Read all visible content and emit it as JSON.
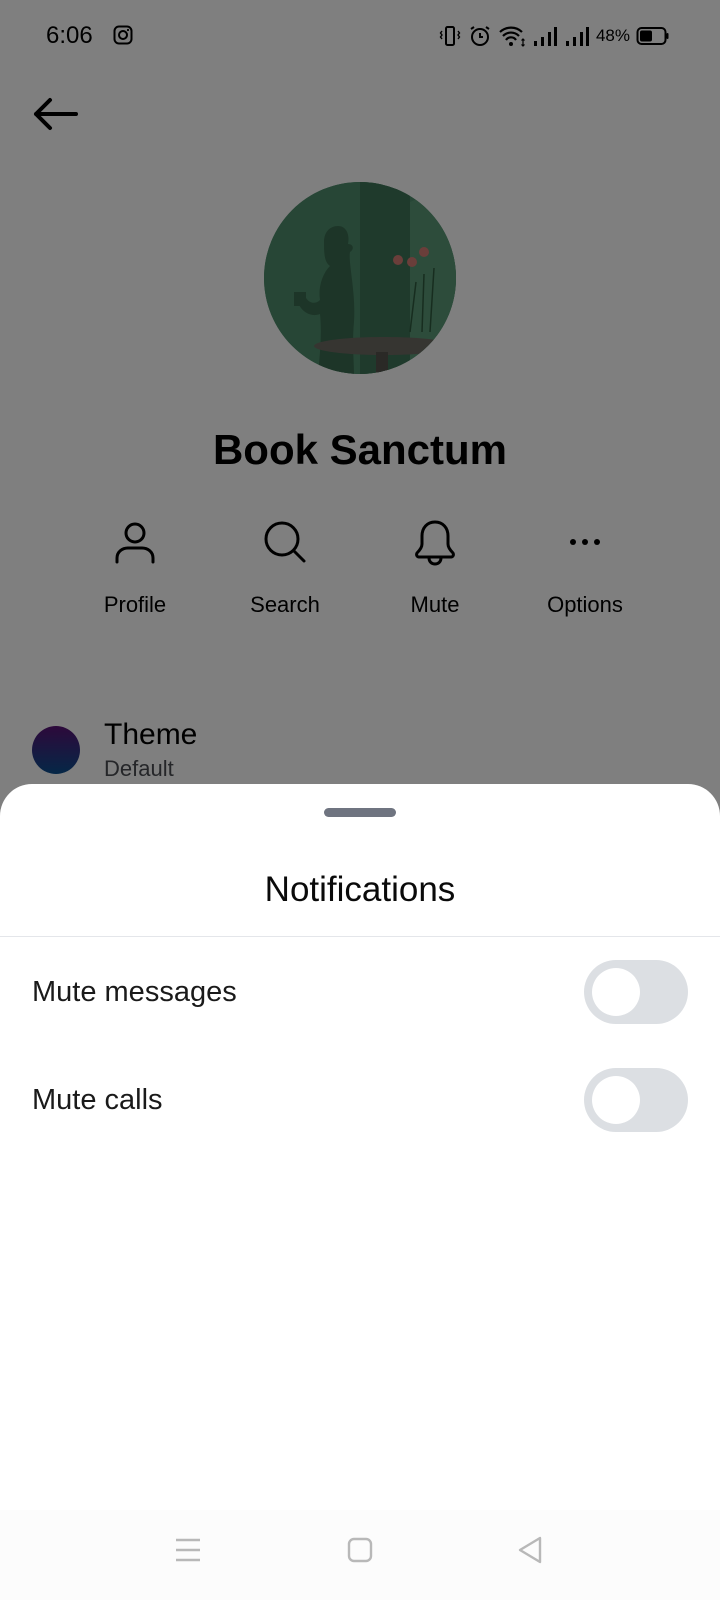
{
  "status_bar": {
    "time": "6:06",
    "notification_icons": [
      "instagram-icon"
    ],
    "system_icons": [
      "vibrate-icon",
      "alarm-icon",
      "wifi-icon",
      "signal-icon",
      "signal-icon"
    ],
    "battery_percent": "48%",
    "battery_level": 0.48
  },
  "header": {
    "back_icon": "arrow-left-icon"
  },
  "chat": {
    "name": "Book Sanctum",
    "avatar_description": "green illustration of woman silhouette with roses on table"
  },
  "actions": [
    {
      "label": "Profile",
      "icon": "person-icon"
    },
    {
      "label": "Search",
      "icon": "search-icon"
    },
    {
      "label": "Mute",
      "icon": "bell-icon"
    },
    {
      "label": "Options",
      "icon": "more-horizontal-icon"
    }
  ],
  "theme": {
    "title": "Theme",
    "value": "Default",
    "colors": [
      "#5a1275",
      "#0a4f8e"
    ]
  },
  "sheet": {
    "title": "Notifications",
    "rows": [
      {
        "label": "Mute messages",
        "enabled": false
      },
      {
        "label": "Mute calls",
        "enabled": false
      }
    ]
  },
  "navbar": {
    "buttons": [
      "menu-icon",
      "home-icon",
      "back-triangle-icon"
    ]
  }
}
